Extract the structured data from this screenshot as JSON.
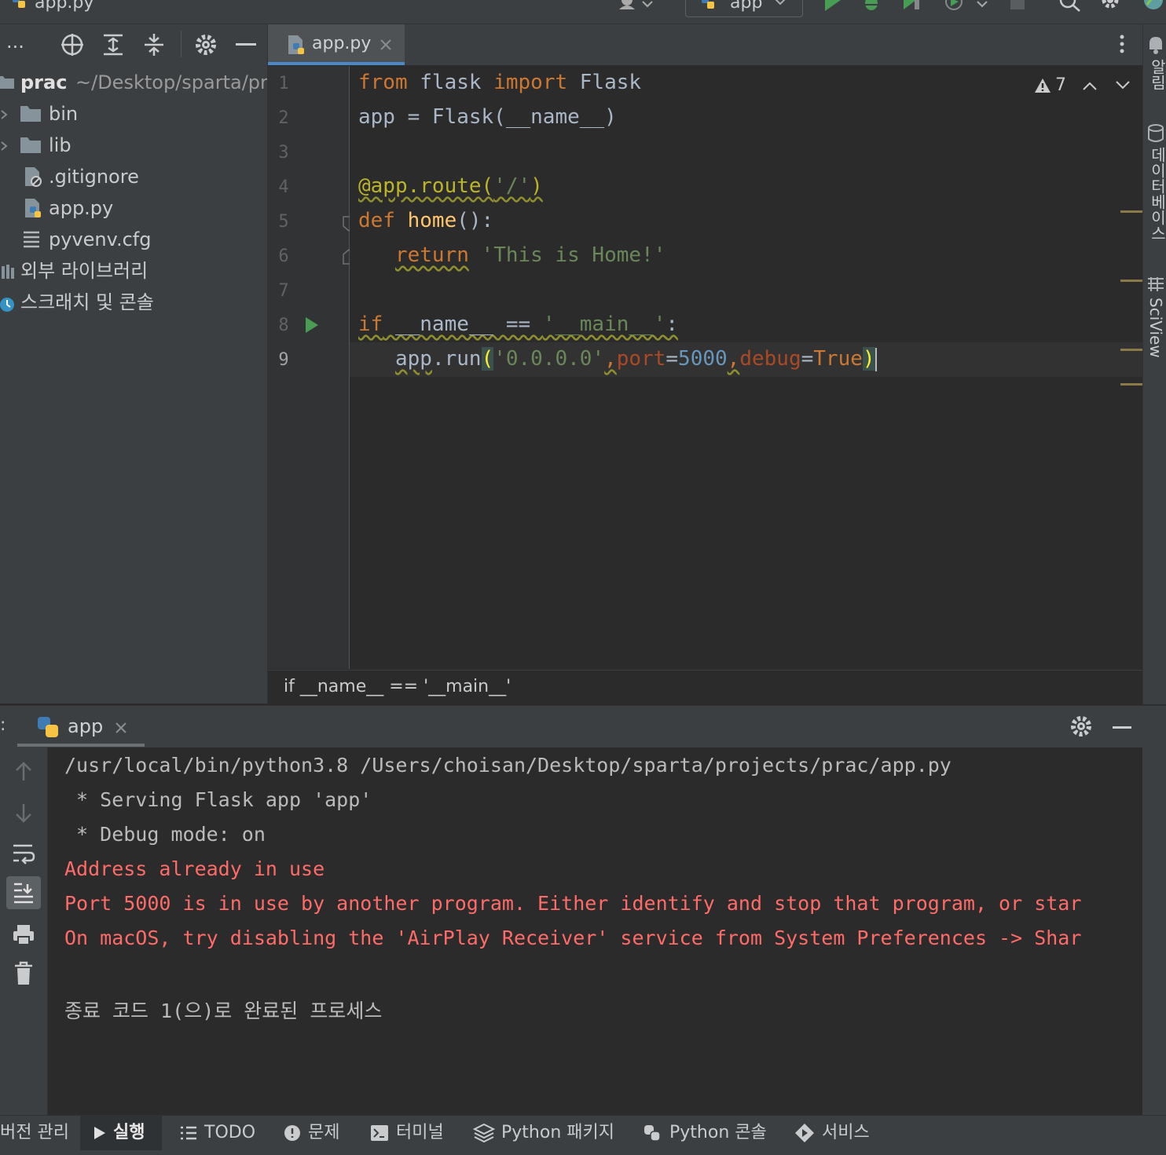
{
  "title_bar": {
    "file_tab": "app.py",
    "run_config": "app"
  },
  "project_panel": {
    "toolbar_label": "...",
    "root": {
      "name": "prac",
      "path": "~/Desktop/sparta/pr"
    },
    "items": [
      {
        "label": "bin",
        "icon": "folder-icon"
      },
      {
        "label": "lib",
        "icon": "folder-icon"
      },
      {
        "label": ".gitignore",
        "icon": "ignore-file-icon"
      },
      {
        "label": "app.py",
        "icon": "python-file-icon"
      },
      {
        "label": "pyvenv.cfg",
        "icon": "config-file-icon"
      },
      {
        "label": "외부 라이브러리",
        "icon": "library-icon"
      },
      {
        "label": "스크래치 및 콘솔",
        "icon": "scratch-icon"
      }
    ]
  },
  "editor": {
    "tab_label": "app.py",
    "warnings_count": "7",
    "line_numbers": [
      "1",
      "2",
      "3",
      "4",
      "5",
      "6",
      "7",
      "8",
      "9"
    ],
    "breadcrumb": "if __name__ == '__main__'"
  },
  "right_strip": {
    "items": [
      "알림",
      "데이터베이스",
      "SciView"
    ]
  },
  "run_panel": {
    "tab_label": "app",
    "lines": [
      {
        "text": "/usr/local/bin/python3.8 /Users/choisan/Desktop/sparta/projects/prac/app.py",
        "kind": "normal"
      },
      {
        "text": " * Serving Flask app 'app'",
        "kind": "normal"
      },
      {
        "text": " * Debug mode: on",
        "kind": "normal"
      },
      {
        "text": "Address already in use",
        "kind": "error"
      },
      {
        "text": "Port 5000 is in use by another program. Either identify and stop that program, or star",
        "kind": "error"
      },
      {
        "text": "On macOS, try disabling the 'AirPlay Receiver' service from System Preferences -> Shar",
        "kind": "error"
      },
      {
        "text": "",
        "kind": "normal"
      },
      {
        "text": "종료 코드 1(으)로 완료된 프로세스",
        "kind": "normal"
      }
    ]
  },
  "status_bar": {
    "items": [
      {
        "label": "버전 관리",
        "icon": "vcs-icon"
      },
      {
        "label": "실행",
        "icon": "run-icon"
      },
      {
        "label": "TODO",
        "icon": "todo-icon"
      },
      {
        "label": "문제",
        "icon": "problems-icon"
      },
      {
        "label": "터미널",
        "icon": "terminal-icon"
      },
      {
        "label": "Python 패키지",
        "icon": "packages-icon"
      },
      {
        "label": "Python 콘솔",
        "icon": "python-console-icon"
      },
      {
        "label": "서비스",
        "icon": "services-icon"
      }
    ]
  }
}
